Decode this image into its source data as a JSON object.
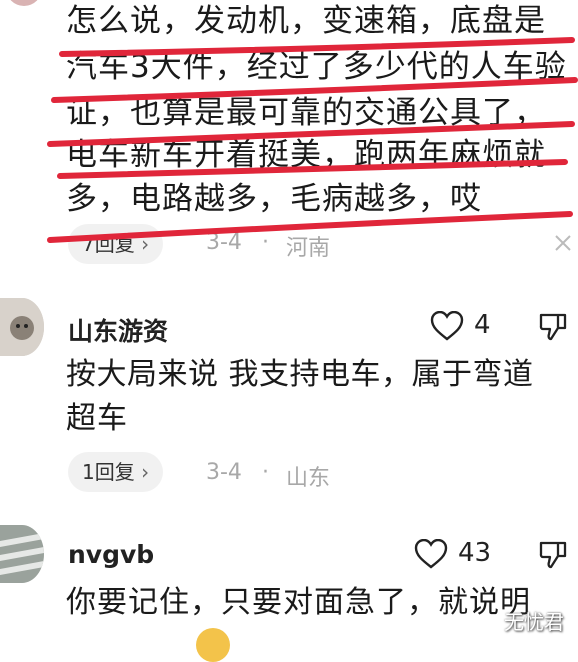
{
  "comment1": {
    "lines": [
      "怎么说，发动机，变速箱，底盘是",
      "汽车3大件，经过了多少代的人车验",
      "证，也算是最可靠的交通公具了，",
      "电车新车开着挺美，跑两年麻烦就",
      "多，电路越多，毛病越多，哎"
    ],
    "replies": "7回复",
    "date": "3-4",
    "location": "河南"
  },
  "comment2": {
    "username": "山东游资",
    "likes": "4",
    "lines": [
      "按大局来说 我支持电车，属于弯道",
      "超车"
    ],
    "replies": "1回复",
    "date": "3-4",
    "location": "山东"
  },
  "comment3": {
    "username": "nvgvb",
    "likes": "43",
    "lines": [
      "你要记住，只要对面急了，就说明"
    ]
  },
  "watermark": "无忧君",
  "colors": {
    "annotation": "#e0263a",
    "meta": "#a8a8a8",
    "pill": "#f1f1f1"
  }
}
